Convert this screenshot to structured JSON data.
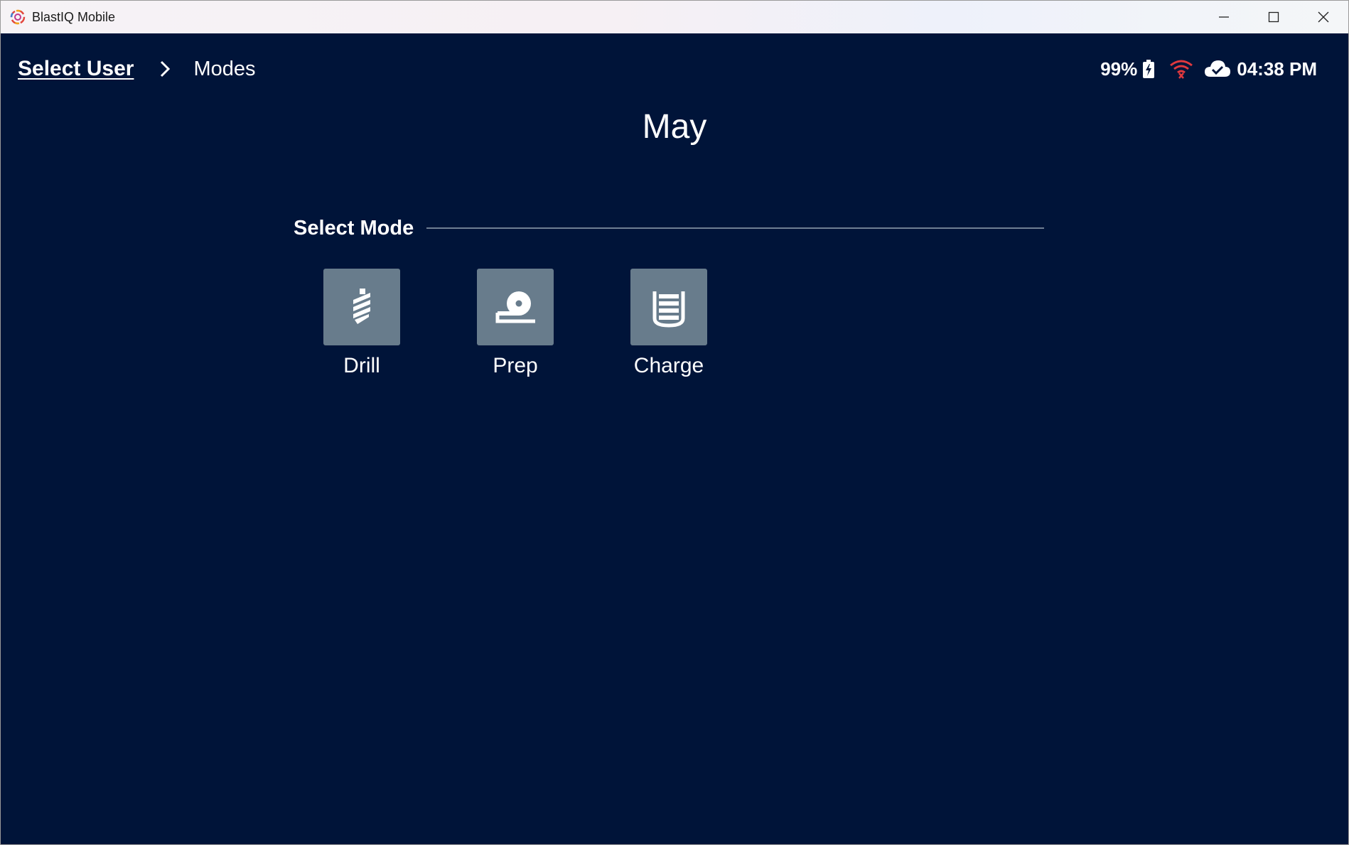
{
  "window": {
    "title": "BlastIQ Mobile",
    "controls": [
      "minimize-icon",
      "maximize-icon",
      "close-icon"
    ]
  },
  "breadcrumb": {
    "link": "Select User",
    "separator_icon": "chevron-right-icon",
    "current": "Modes"
  },
  "status": {
    "battery": "99%",
    "battery_icon": "battery-charging-icon",
    "wifi_icon": "wifi-off-icon",
    "wifi_color": "#e0393e",
    "cloud_icon": "cloud-check-icon",
    "time": "04:38 PM"
  },
  "user": {
    "name": "May"
  },
  "section": {
    "title": "Select Mode"
  },
  "modes": [
    {
      "label": "Drill",
      "icon": "drill-icon"
    },
    {
      "label": "Prep",
      "icon": "tape-measure-icon"
    },
    {
      "label": "Charge",
      "icon": "charge-canister-icon"
    }
  ],
  "colors": {
    "background": "#001439",
    "tile": "#687c8c",
    "text": "#ffffff"
  }
}
